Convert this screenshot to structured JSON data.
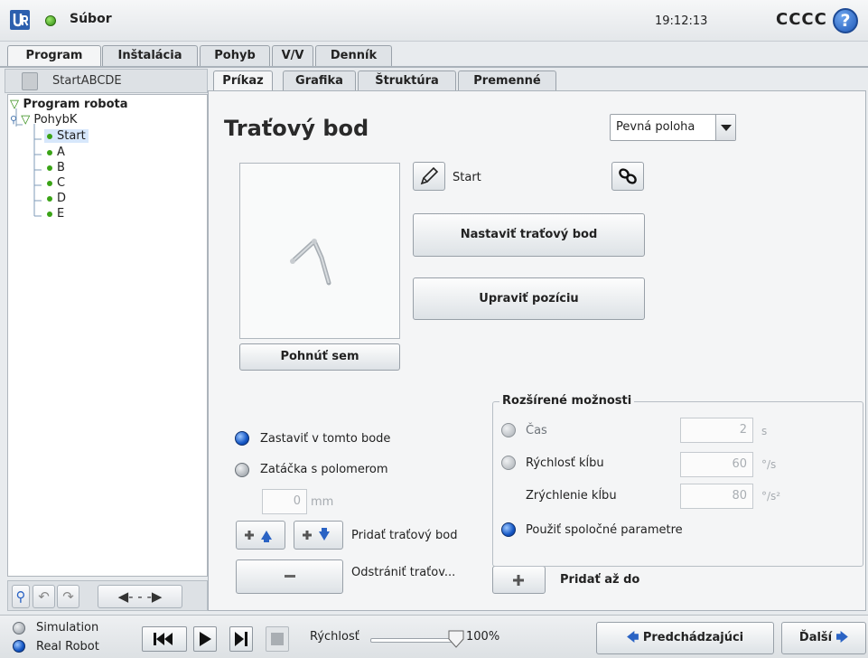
{
  "header": {
    "file_menu": "Súbor",
    "clock": "19:12:13",
    "robot_name": "CCCC",
    "help": "?"
  },
  "main_tabs": [
    {
      "label": "Program",
      "active": true
    },
    {
      "label": "Inštalácia",
      "active": false
    },
    {
      "label": "Pohyb",
      "active": false
    },
    {
      "label": "V/V",
      "active": false
    },
    {
      "label": "Denník",
      "active": false
    }
  ],
  "program": {
    "name": "StartABCDE",
    "tree": {
      "root": "Program robota",
      "move": "PohybK",
      "waypoints": [
        "Start",
        "A",
        "B",
        "C",
        "D",
        "E"
      ],
      "selected": "Start"
    }
  },
  "sub_tabs": [
    {
      "label": "Príkaz",
      "active": true
    },
    {
      "label": "Grafika",
      "active": false
    },
    {
      "label": "Štruktúra",
      "active": false
    },
    {
      "label": "Premenné",
      "active": false
    }
  ],
  "waypoint": {
    "title": "Traťový bod",
    "position_type": "Pevná poloha",
    "name": "Start",
    "set_button": "Nastaviť traťový bod",
    "edit_button": "Upraviť pozíciu",
    "move_here_button": "Pohnúť sem",
    "stop_here": "Zastaviť v tomto bode",
    "blend_radius": "Zatáčka s polomerom",
    "blend_value": "0",
    "blend_unit": "mm",
    "add_waypoint_label": "Pridať traťový bod",
    "remove_waypoint_label": "Odstrániť traťov...",
    "add_until_label": "Pridať až do"
  },
  "advanced": {
    "title": "Rozšírené možnosti",
    "time_label": "Čas",
    "time_value": "2",
    "time_unit": "s",
    "joint_speed_label": "Rýchlosť kĺbu",
    "joint_speed_value": "60",
    "joint_speed_unit": "°/s",
    "joint_accel_label": "Zrýchlenie kĺbu",
    "joint_accel_value": "80",
    "joint_accel_unit": "°/s²",
    "shared_params_label": "Použiť spoločné parametre",
    "selected": "shared"
  },
  "footer": {
    "simulation": "Simulation",
    "real_robot": "Real Robot",
    "mode_selected": "real_robot",
    "speed_label": "Rýchlosť",
    "speed_value": "100%",
    "speed_fraction": 1.0,
    "prev_button": "Predchádzajúci",
    "next_button": "Ďalší"
  },
  "colors": {
    "accent_blue": "#1f59b8",
    "tree_dot_green": "#3aa316",
    "status_green": "#2f8a12"
  }
}
